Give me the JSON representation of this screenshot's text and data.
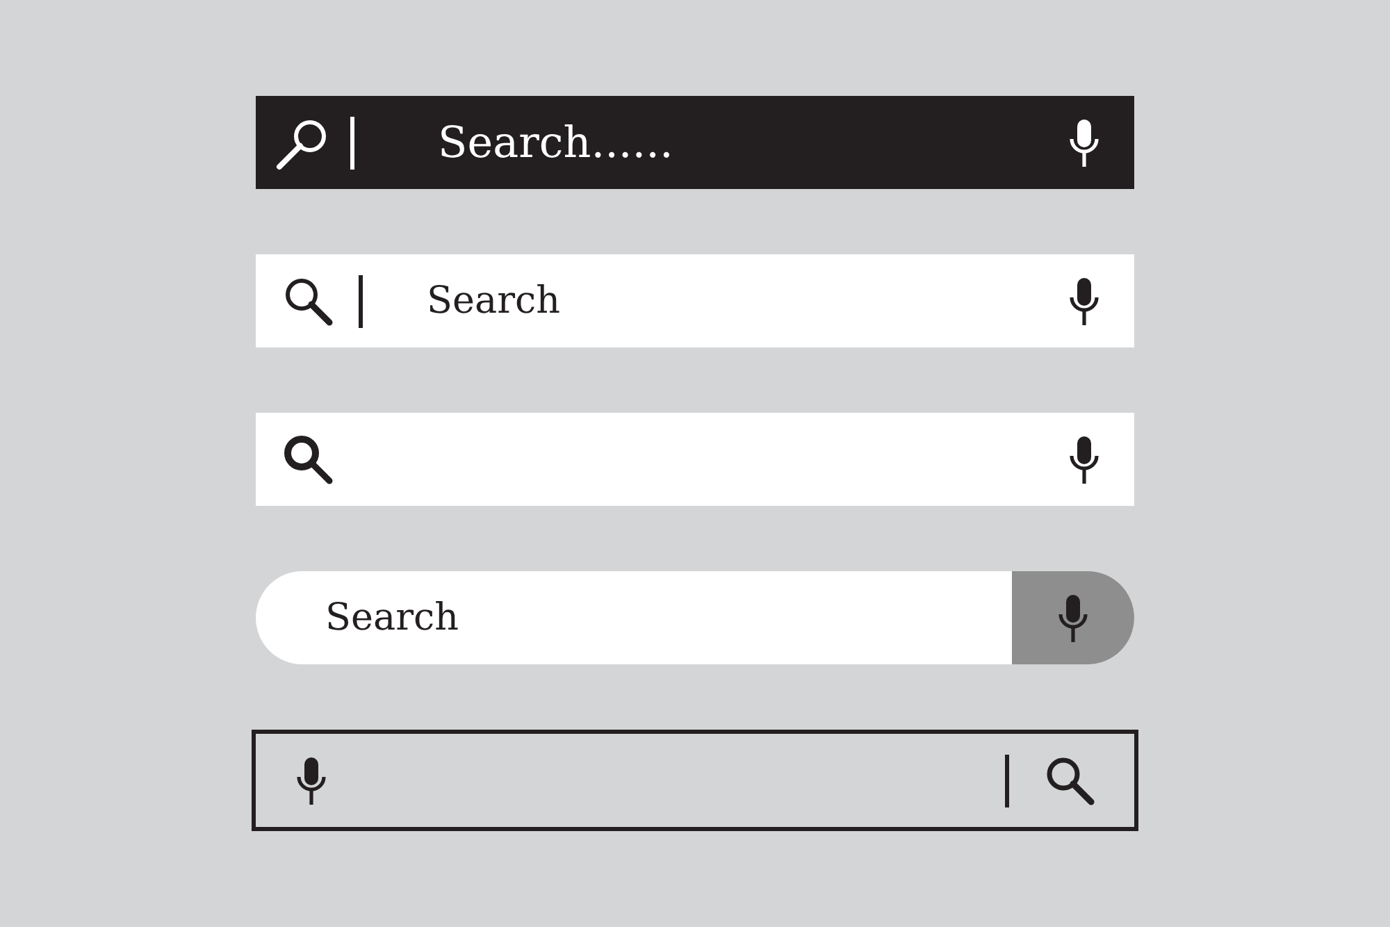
{
  "search_bars": [
    {
      "kind": "dark",
      "placeholder": "Search......"
    },
    {
      "kind": "light",
      "placeholder": "Search"
    },
    {
      "kind": "plain"
    },
    {
      "kind": "pill",
      "placeholder": "Search"
    },
    {
      "kind": "outline"
    }
  ]
}
